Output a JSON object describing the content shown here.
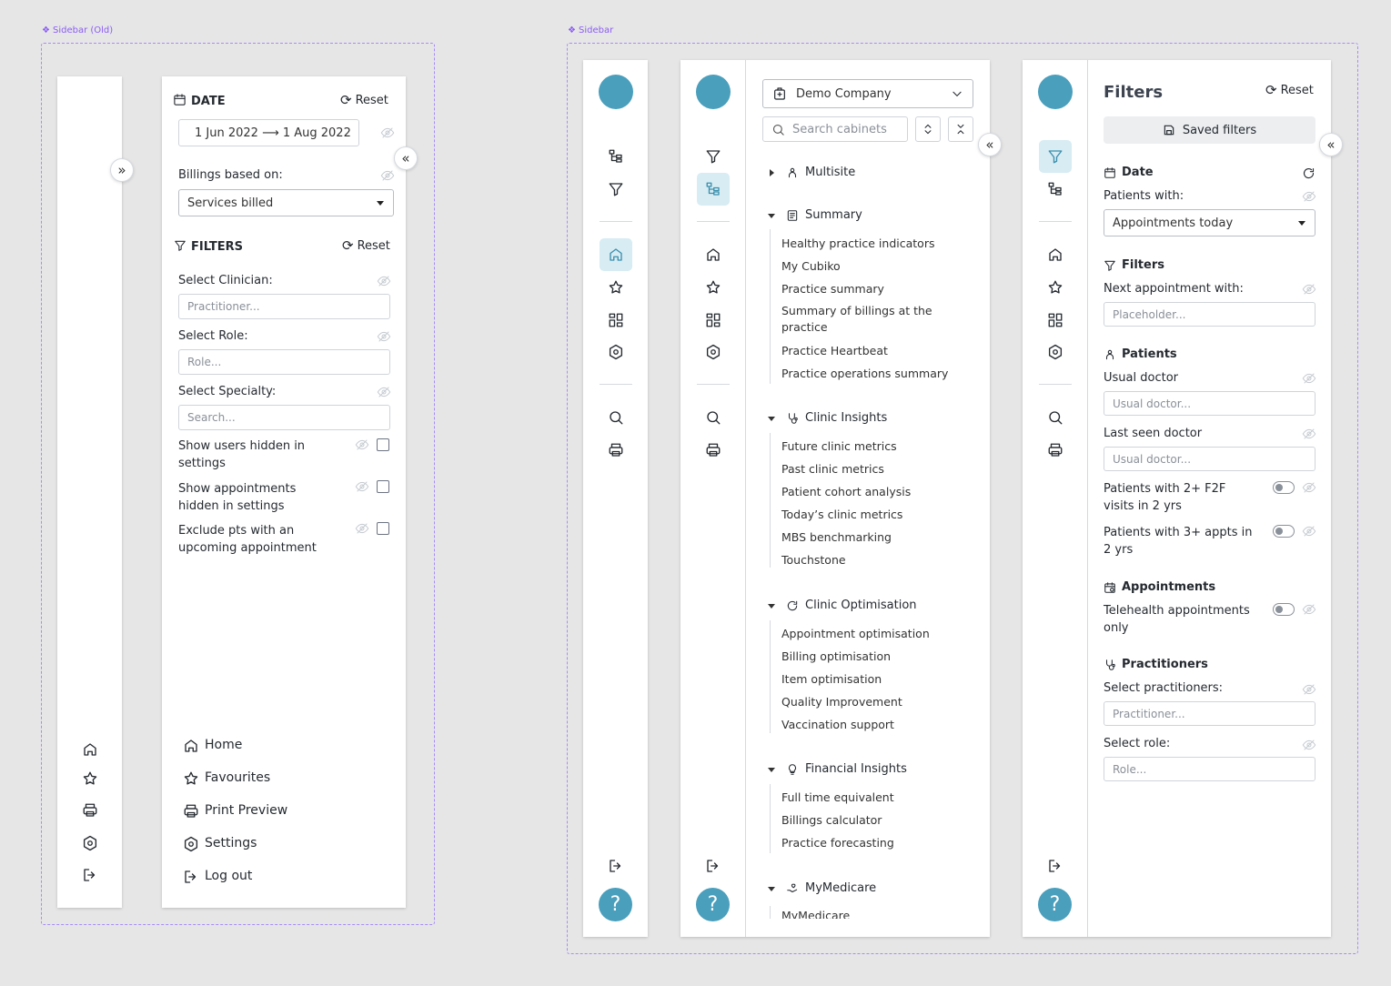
{
  "frames": {
    "old_label": "Sidebar (Old)",
    "new_label": "Sidebar"
  },
  "old": {
    "date_heading": "DATE",
    "reset": "Reset",
    "date_range": "1 Jun 2022 ⟶ 1 Aug 2022",
    "billings_label": "Billings based on:",
    "billings_value": "Services billed",
    "filters_heading": "FILTERS",
    "filters_reset": "Reset",
    "clinician_label": "Select Clinician:",
    "clinician_placeholder": "Practitioner...",
    "role_label": "Select Role:",
    "role_placeholder": "Role...",
    "specialty_label": "Select Specialty:",
    "specialty_placeholder": "Search...",
    "show_users_hidden": "Show users hidden in settings",
    "show_appts_hidden": "Show appointments hidden in settings",
    "exclude_pts": "Exclude pts with an upcoming appointment",
    "nav": {
      "home": "Home",
      "favourites": "Favourites",
      "print": "Print Preview",
      "settings": "Settings",
      "logout": "Log out"
    }
  },
  "nav_panel": {
    "company": "Demo Company",
    "search_placeholder": "Search cabinets",
    "sections": [
      {
        "title": "Multisite",
        "items": []
      },
      {
        "title": "Summary",
        "items": [
          "Healthy practice indicators",
          "My Cubiko",
          "Practice summary",
          "Summary of billings at the practice",
          "Practice Heartbeat",
          "Practice operations summary"
        ]
      },
      {
        "title": "Clinic Insights",
        "items": [
          "Future clinic metrics",
          "Past clinic metrics",
          "Patient cohort analysis",
          "Today’s clinic metrics",
          "MBS benchmarking",
          "Touchstone"
        ]
      },
      {
        "title": "Clinic Optimisation",
        "items": [
          "Appointment optimisation",
          "Billing optimisation",
          "Item optimisation",
          "Quality Improvement",
          "Vaccination support"
        ]
      },
      {
        "title": "Financial Insights",
        "items": [
          "Full time equivalent",
          "Billings calculator",
          "Practice forecasting"
        ]
      },
      {
        "title": "MyMedicare",
        "items": [
          "MyMedicare"
        ]
      }
    ]
  },
  "filters_panel": {
    "title": "Filters",
    "reset": "Reset",
    "saved_filters": "Saved filters",
    "date_heading": "Date",
    "patients_with_label": "Patients with:",
    "patients_with_value": "Appointments today",
    "filters_heading": "Filters",
    "next_appt_label": "Next appointment with:",
    "next_appt_placeholder": "Placeholder...",
    "patients_heading": "Patients",
    "usual_doctor_label": "Usual doctor",
    "usual_doctor_placeholder": "Usual doctor...",
    "last_seen_label": "Last seen doctor",
    "last_seen_placeholder": "Usual doctor...",
    "f2f_label": "Patients with 2+ F2F visits in 2 yrs",
    "appts3_label": "Patients with 3+ appts in 2 yrs",
    "appointments_heading": "Appointments",
    "telehealth_label": "Telehealth appointments only",
    "practitioners_heading": "Practitioners",
    "select_practitioners_label": "Select practitioners:",
    "practitioners_placeholder": "Practitioner...",
    "select_role_label": "Select role:",
    "role_placeholder": "Role..."
  },
  "help_label": "?",
  "accent": "#4a9fbc",
  "frame_color": "#a78bfa"
}
